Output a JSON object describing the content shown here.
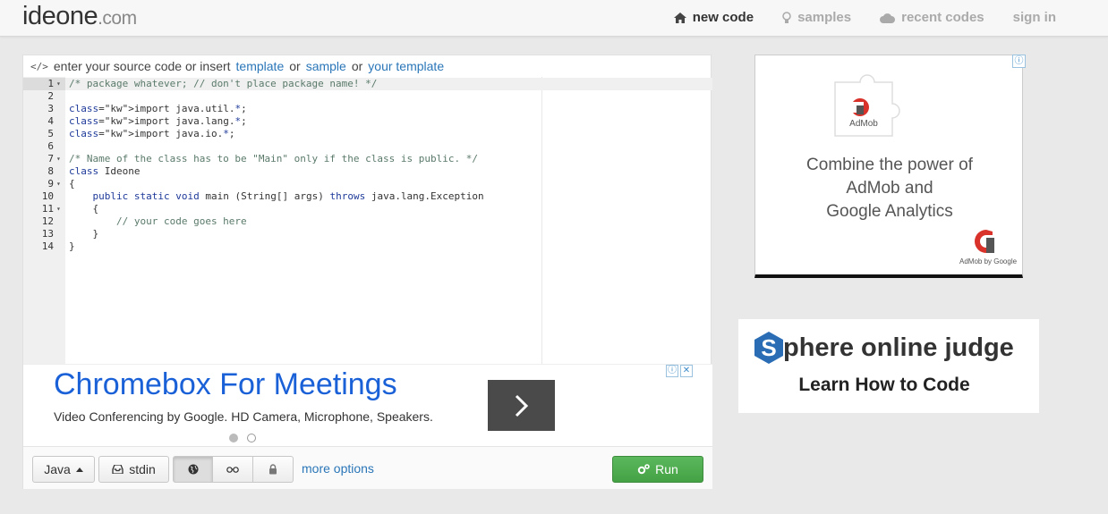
{
  "header": {
    "logo_main": "ideone",
    "logo_domain": ".com",
    "nav": [
      {
        "label": "new code",
        "icon": "home-icon",
        "active": true
      },
      {
        "label": "samples",
        "icon": "lightbulb-icon",
        "active": false
      },
      {
        "label": "recent codes",
        "icon": "cloud-icon",
        "active": false
      },
      {
        "label": "sign in",
        "icon": "",
        "active": false
      }
    ]
  },
  "editor": {
    "prompt": {
      "icon": "</>",
      "prefix": "enter your source code or insert",
      "template_link": "template",
      "or1": "or",
      "sample_link": "sample",
      "or2": "or",
      "your_template_link": "your template"
    },
    "lines": [
      {
        "n": "1",
        "fold": true,
        "text": "/* package whatever; // don't place package name! */"
      },
      {
        "n": "2",
        "fold": false,
        "text": ""
      },
      {
        "n": "3",
        "fold": false,
        "text": "import java.util.*;"
      },
      {
        "n": "4",
        "fold": false,
        "text": "import java.lang.*;"
      },
      {
        "n": "5",
        "fold": false,
        "text": "import java.io.*;"
      },
      {
        "n": "6",
        "fold": false,
        "text": ""
      },
      {
        "n": "7",
        "fold": true,
        "text": "/* Name of the class has to be \"Main\" only if the class is public. */"
      },
      {
        "n": "8",
        "fold": false,
        "text": "class Ideone"
      },
      {
        "n": "9",
        "fold": true,
        "text": "{"
      },
      {
        "n": "10",
        "fold": false,
        "text": "    public static void main (String[] args) throws java.lang.Exception"
      },
      {
        "n": "11",
        "fold": true,
        "text": "    {"
      },
      {
        "n": "12",
        "fold": false,
        "text": "        // your code goes here"
      },
      {
        "n": "13",
        "fold": false,
        "text": "    }"
      },
      {
        "n": "14",
        "fold": false,
        "text": "}"
      }
    ]
  },
  "ad_banner": {
    "title": "Chromebox For Meetings",
    "description": "Video Conferencing by Google. HD Camera, Microphone, Speakers.",
    "info_glyph": "ⓘ",
    "close_glyph": "✕"
  },
  "toolbar": {
    "language": "Java",
    "stdin_label": "stdin",
    "more_options": "more options",
    "run_label": "Run"
  },
  "admob": {
    "puzzle_label": "AdMob",
    "text_lines": [
      "Combine the power of",
      "AdMob and",
      "Google Analytics"
    ],
    "by_label": "AdMob by Google",
    "info_glyph": "ⓘ"
  },
  "sphere": {
    "title_letter": "S",
    "title_rest": "phere online judge",
    "subtitle": "Learn How to Code"
  },
  "colors": {
    "link": "#2a76b8",
    "run_green": "#4cae4c",
    "ad_title_blue": "#1a61d8",
    "admob_red": "#d8322a",
    "sphere_blue": "#2a6db5"
  }
}
